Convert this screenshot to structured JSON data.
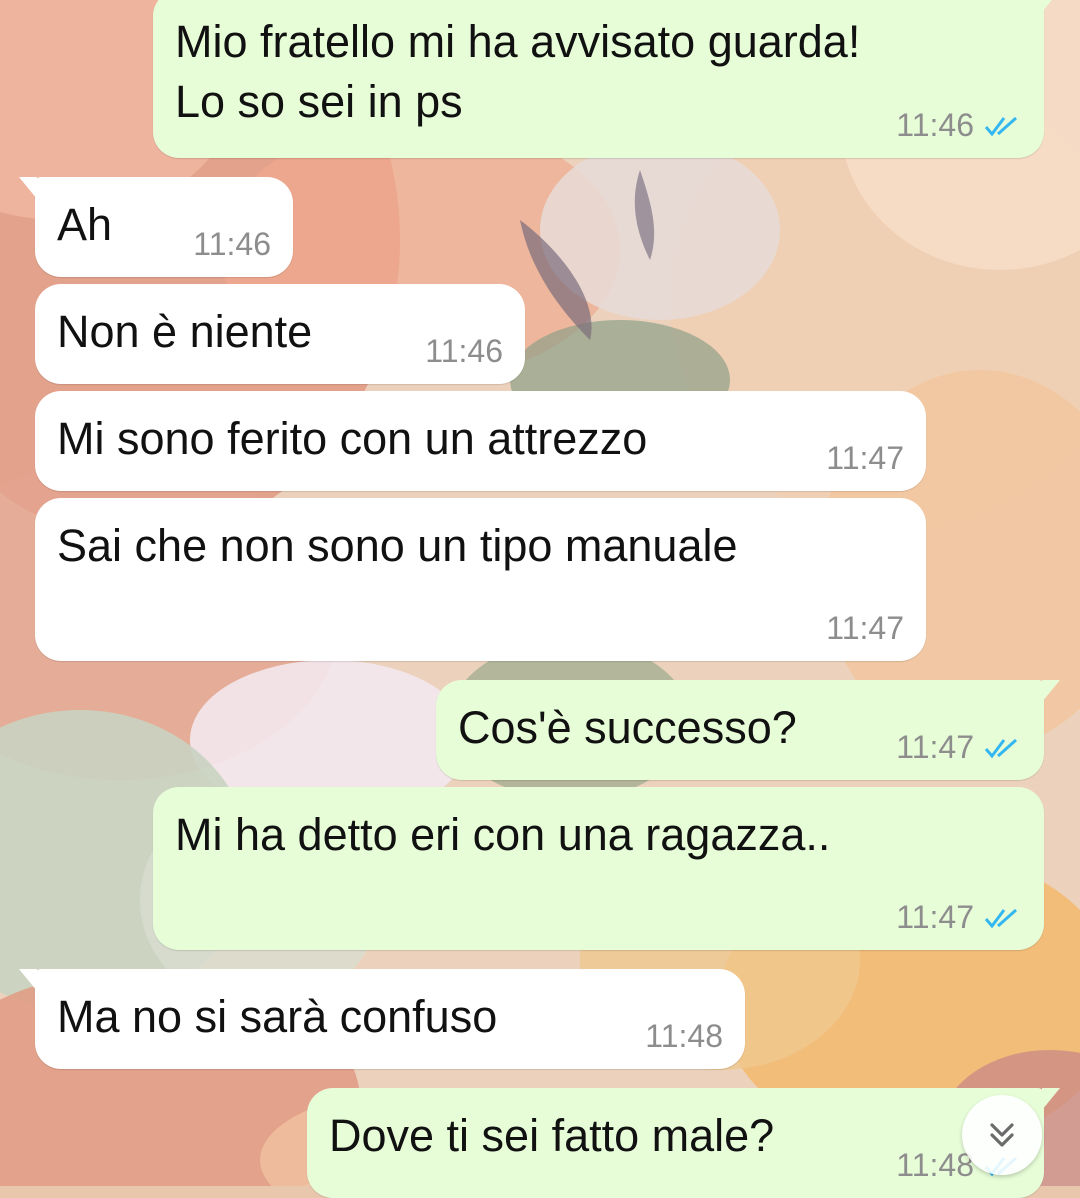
{
  "colors": {
    "incoming_bubble": "#ffffff",
    "outgoing_bubble": "#e7fdd8",
    "timestamp": "#8d8d8d",
    "read_ticks": "#34b7f1"
  },
  "chat": {
    "wallpaper": "floral-watercolor",
    "messages": [
      {
        "direction": "out",
        "text": "Mio fratello mi ha avvisato guarda!\nLo so sei in ps",
        "time": "11:46",
        "status": "read"
      },
      {
        "direction": "in",
        "text": "Ah",
        "time": "11:46"
      },
      {
        "direction": "in",
        "text": "Non è niente",
        "time": "11:46"
      },
      {
        "direction": "in",
        "text": "Mi sono ferito con un attrezzo",
        "time": "11:47"
      },
      {
        "direction": "in",
        "text": "Sai che non sono un tipo manuale",
        "time": "11:47"
      },
      {
        "direction": "out",
        "text": "Cos'è successo?",
        "time": "11:47",
        "status": "read"
      },
      {
        "direction": "out",
        "text": "Mi ha detto eri con una ragazza..",
        "time": "11:47",
        "status": "read"
      },
      {
        "direction": "in",
        "text": "Ma no si sarà confuso",
        "time": "11:48"
      },
      {
        "direction": "out",
        "text": "Dove ti sei fatto male?",
        "time": "11:48",
        "status": "read"
      }
    ]
  },
  "scroll_button": {
    "icon": "double-chevron-down-icon"
  }
}
